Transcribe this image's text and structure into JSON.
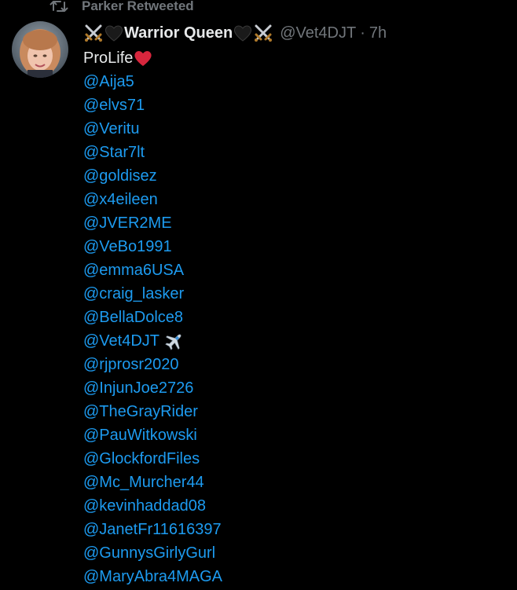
{
  "retweet": {
    "label": "Parker Retweeted",
    "icon": "retweet-icon"
  },
  "author": {
    "name": "Warrior Queen",
    "name_prefix_icons": [
      "crossed-swords-icon",
      "black-heart-icon"
    ],
    "name_suffix_icons": [
      "black-heart-icon",
      "crossed-swords-icon"
    ],
    "handle": "@Vet4DJT",
    "separator": "·",
    "time": "7h",
    "avatar": "avatar"
  },
  "tweet": {
    "first_line": "ProLife",
    "first_line_icon": "red-heart-icon",
    "mentions": [
      "@Aija5",
      "@elvs71",
      "@Veritu",
      "@Star7lt",
      "@goldisez",
      "@x4eileen",
      "@JVER2ME",
      "@VeBo1991",
      "@emma6USA",
      "@craig_lasker",
      "@BellaDolce8",
      "@Vet4DJT",
      "@rjprosr2020",
      "@InjunJoe2726",
      "@TheGrayRider",
      "@PauWitkowski",
      "@GlockfordFiles",
      "@Mc_Murcher44",
      "@kevinhaddad08",
      "@JanetFr11616397",
      "@GunnysGirlyGurl",
      "@MaryAbra4MAGA"
    ],
    "plane_after_index": 11,
    "plane_icon": "airplane-icon"
  },
  "colors": {
    "background": "#000000",
    "text": "#e7e9ea",
    "secondary": "#71767b",
    "link": "#1d9bf0",
    "heart": "#d7263d"
  }
}
